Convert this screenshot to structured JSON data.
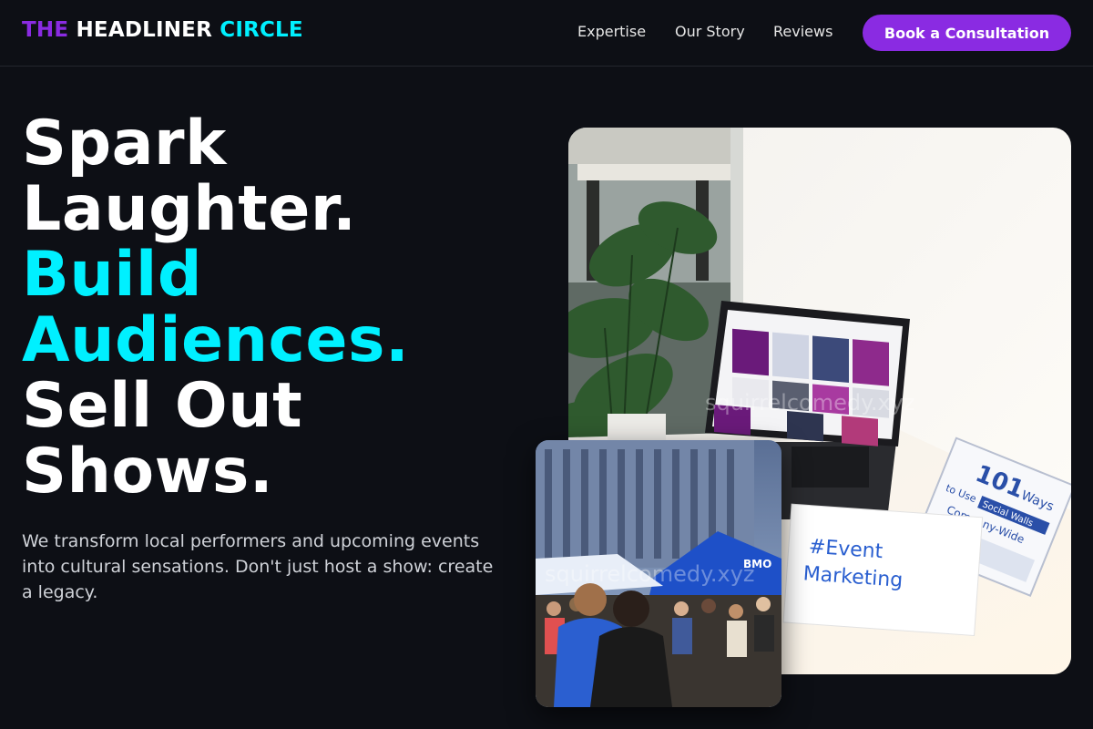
{
  "brand": {
    "part1": "THE",
    "part2": "HEADLINER",
    "part3": "CIRCLE"
  },
  "nav": {
    "links": [
      "Expertise",
      "Our Story",
      "Reviews"
    ],
    "cta": "Book a Consultation"
  },
  "hero": {
    "headline_lines": [
      "Spark",
      "Laughter.",
      "Build",
      "Audiences.",
      "Sell Out",
      "Shows."
    ],
    "subtitle": "We transform local performers and upcoming events into cultural sensations. Don't just host a show: create a legacy."
  },
  "images": {
    "main": {
      "card_text_1": "#Event",
      "card_text_2": "Marketing",
      "book_title_1": "101",
      "book_title_2": "Ways",
      "book_title_3": "to Use",
      "book_title_4": "Social Walls",
      "book_title_5": "Company-Wide",
      "watermark": "squirrelcomedy.xyz"
    },
    "secondary": {
      "sign": "BMO",
      "watermark": "squirrelcomedy.xyz"
    }
  },
  "colors": {
    "purple": "#8a2be2",
    "cyan": "#00f0ff",
    "background": "#0d0f15"
  }
}
